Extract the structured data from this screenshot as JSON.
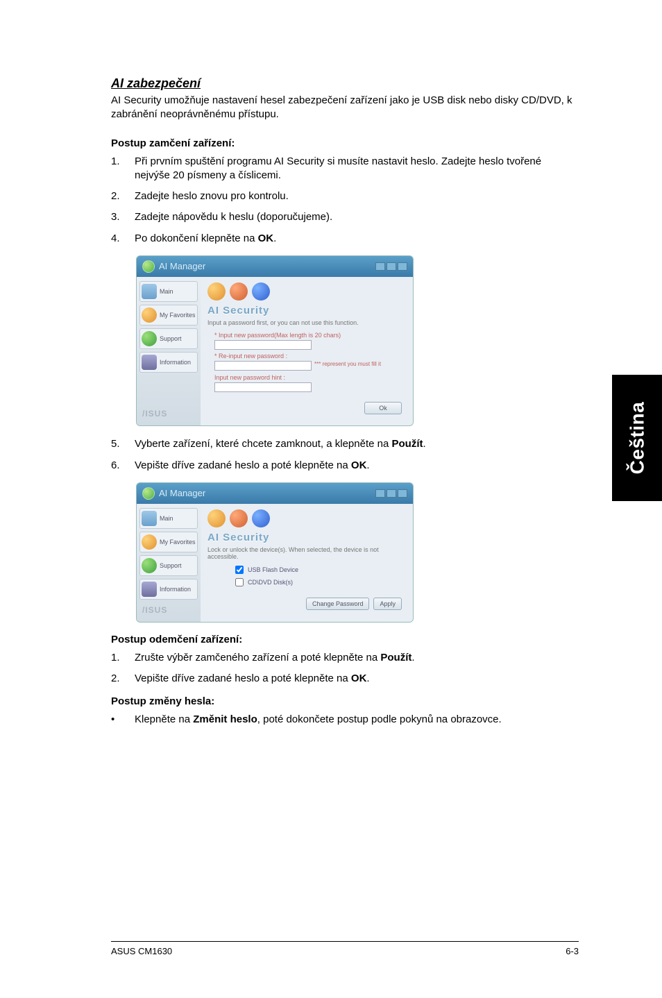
{
  "title": "AI zabezpečení",
  "intro": "AI Security umožňuje nastavení hesel zabezpečení zařízení jako je USB disk nebo disky CD/DVD, k zabránění neoprávněnému přístupu.",
  "lock_heading": "Postup zamčení zařízení:",
  "lock_steps": [
    {
      "n": "1.",
      "t": "Při prvním spuštění programu AI Security si musíte nastavit heslo. Zadejte heslo tvořené nejvýše 20 písmeny a číslicemi."
    },
    {
      "n": "2.",
      "t": "Zadejte heslo znovu pro kontrolu."
    },
    {
      "n": "3.",
      "t": "Zadejte nápovědu k heslu (doporučujeme)."
    },
    {
      "n": "4.",
      "t_pre": "Po dokončení klepněte na ",
      "bold": "OK",
      "t_post": "."
    }
  ],
  "lock_steps2": [
    {
      "n": "5.",
      "t_pre": "Vyberte zařízení, které chcete zamknout, a klepněte na ",
      "bold": "Použít",
      "t_post": "."
    },
    {
      "n": "6.",
      "t_pre": "Vepište dříve zadané heslo a poté klepněte na ",
      "bold": "OK",
      "t_post": "."
    }
  ],
  "unlock_heading": "Postup odemčení zařízení:",
  "unlock_steps": [
    {
      "n": "1.",
      "t_pre": "Zrušte výběr zamčeného zařízení a poté klepněte na ",
      "bold": "Použít",
      "t_post": "."
    },
    {
      "n": "2.",
      "t_pre": "Vepište dříve zadané heslo a poté klepněte na ",
      "bold": "OK",
      "t_post": "."
    }
  ],
  "change_heading": "Postup změny hesla:",
  "change_item": {
    "bullet": "•",
    "t_pre": "Klepněte na ",
    "bold": "Změnit heslo",
    "t_post": ", poté dokončete postup podle pokynů na obrazovce."
  },
  "sidetab": "Čeština",
  "footer_left": "ASUS CM1630",
  "footer_right": "6-3",
  "ss1": {
    "title": "AI Manager",
    "side": {
      "main": "Main",
      "fav": "My Favorites",
      "sup": "Support",
      "inf": "Information",
      "brand": "/ISUS"
    },
    "header": "AI Security",
    "note": "Input a password first, or you can not use this function.",
    "f1": "Input new password(Max length is 20 chars)",
    "f2": "Re-input new password :",
    "warn": "*** represent you must fill it",
    "f3": "Input new password hint :",
    "ok": "Ok"
  },
  "ss2": {
    "title": "AI Manager",
    "side": {
      "main": "Main",
      "fav": "My Favorites",
      "sup": "Support",
      "inf": "Information",
      "brand": "/ISUS"
    },
    "header": "AI Security",
    "note": "Lock or unlock the device(s). When selected, the device is not accessible.",
    "dev1": "USB Flash Device",
    "dev2": "CD\\DVD Disk(s)",
    "btn_change": "Change Password",
    "btn_apply": "Apply"
  }
}
